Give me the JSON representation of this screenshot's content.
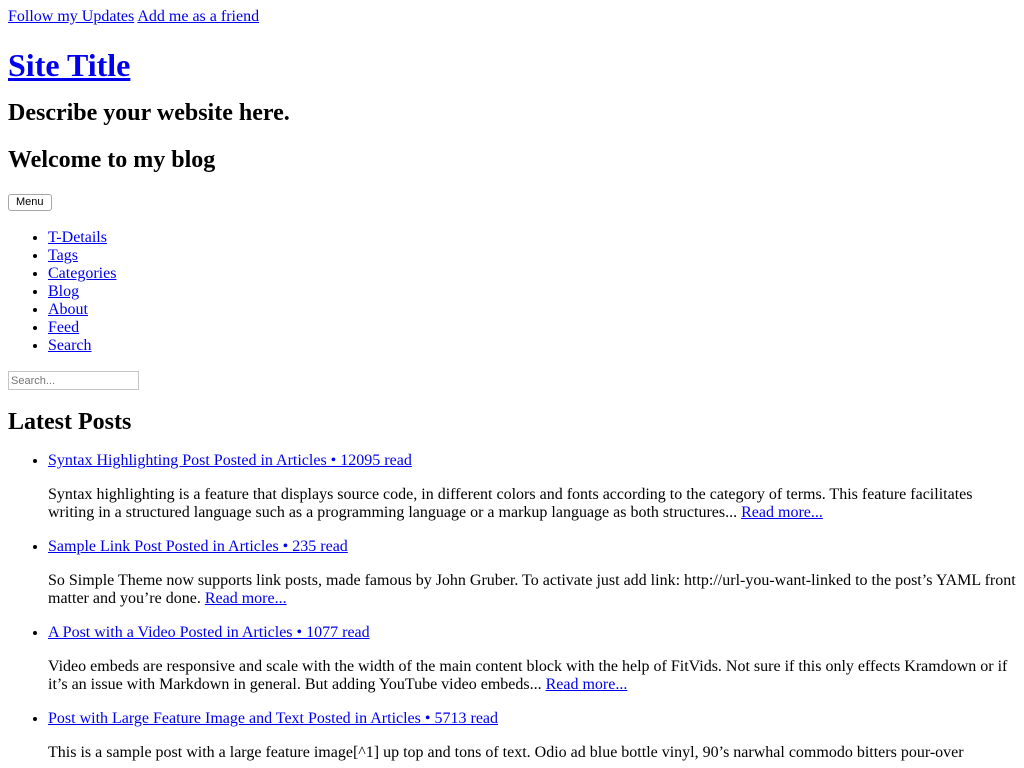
{
  "top_links": {
    "follow": "Follow my Updates",
    "add_friend": "Add me as a friend"
  },
  "site": {
    "title": "Site Title",
    "tagline": "Describe your website here.",
    "welcome": "Welcome to my blog"
  },
  "menu_button": "Menu",
  "nav": [
    "T-Details",
    "Tags",
    "Categories",
    "Blog",
    "About",
    "Feed",
    "Search"
  ],
  "search": {
    "placeholder": "Search..."
  },
  "latest_heading": "Latest Posts",
  "posts": [
    {
      "link": "Syntax Highlighting Post Posted in Articles •  12095 read",
      "excerpt": "Syntax highlighting is a feature that displays source code, in different colors and fonts according to the category of terms. This feature facilitates writing in a structured language such as a programming language or a markup language as both structures...",
      "read_more": " Read more..."
    },
    {
      "link": "Sample Link Post Posted in Articles •  235 read",
      "excerpt": "So Simple Theme now supports link posts, made famous by John Gruber. To activate just add link: http://url-you-want-linked to the post’s YAML front matter and you’re done. ",
      "read_more": " Read more..."
    },
    {
      "link": "A Post with a Video Posted in Articles •  1077 read",
      "excerpt": "Video embeds are responsive and scale with the width of the main content block with the help of FitVids. Not sure if this only effects Kramdown or if it’s an issue with Markdown in general. But adding YouTube video embeds...",
      "read_more": " Read more..."
    },
    {
      "link": "Post with Large Feature Image and Text Posted in Articles •  5713 read",
      "excerpt": "This is a sample post with a large feature image[^1] up top and tons of text. Odio ad blue bottle vinyl, 90’s narwhal commodo bitters pour-over",
      "read_more": ""
    }
  ]
}
